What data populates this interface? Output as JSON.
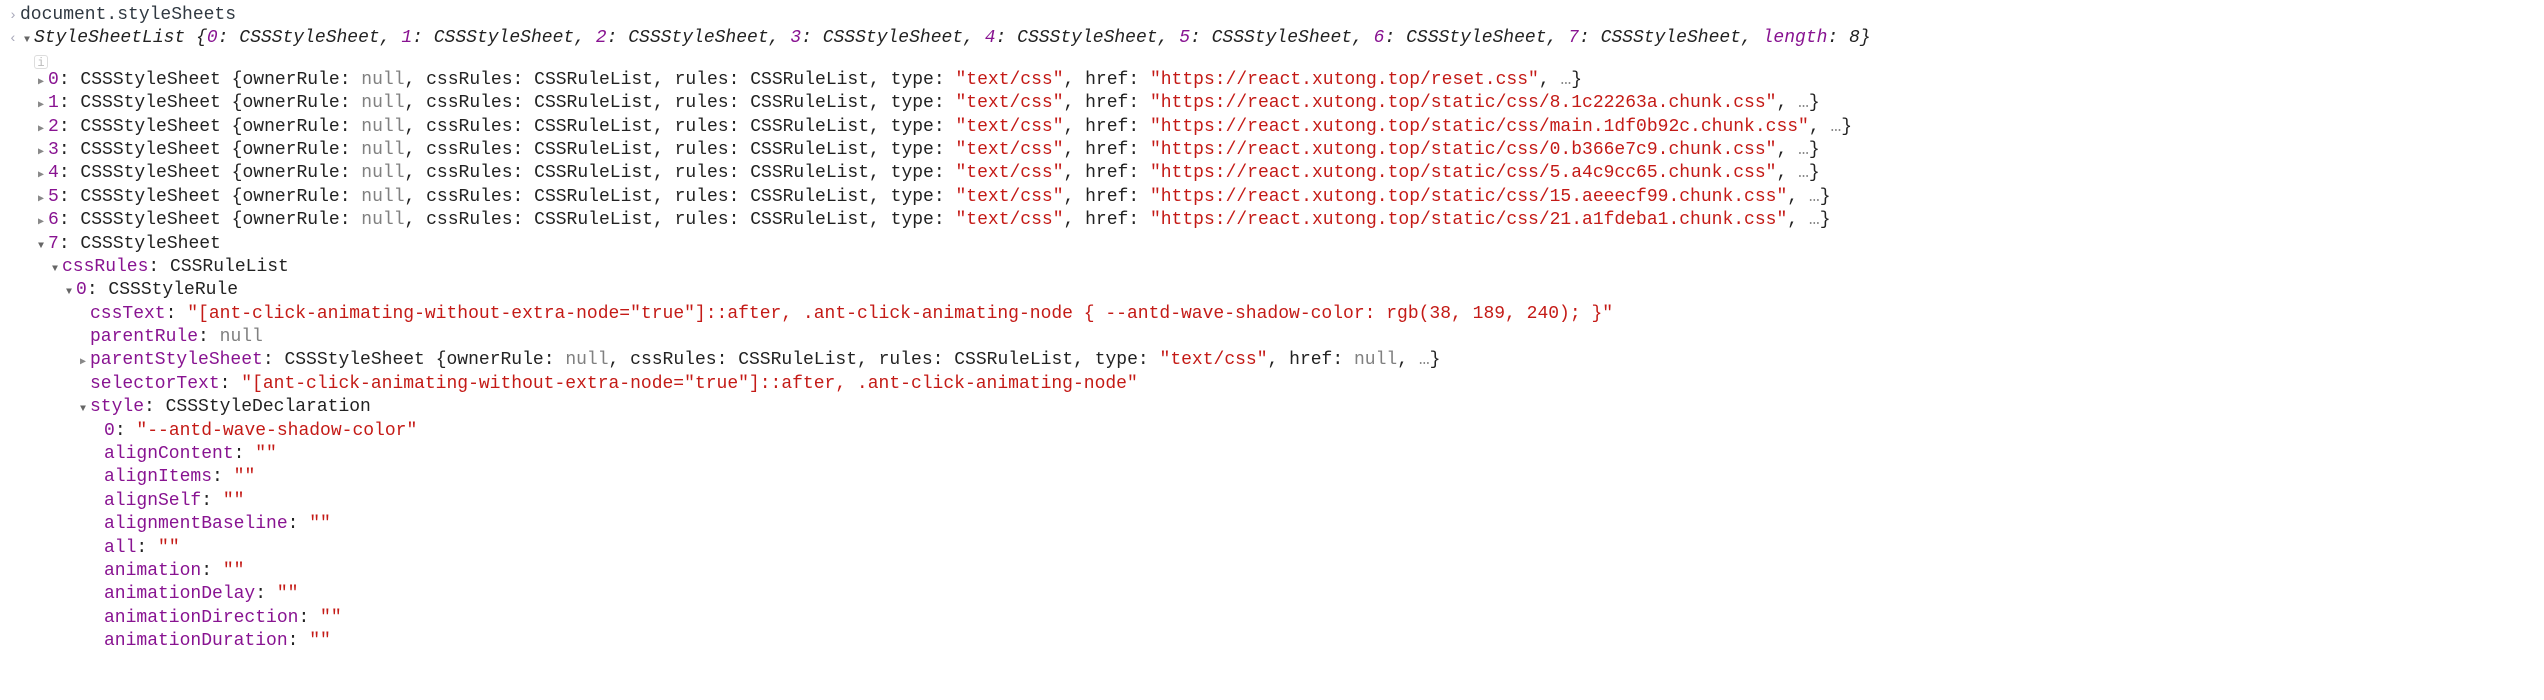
{
  "input": "document.styleSheets",
  "output_summary": {
    "type": "StyleSheetList",
    "length_label": "length",
    "length_value": "8",
    "entries": [
      {
        "k": "0",
        "v": "CSSStyleSheet"
      },
      {
        "k": "1",
        "v": "CSSStyleSheet"
      },
      {
        "k": "2",
        "v": "CSSStyleSheet"
      },
      {
        "k": "3",
        "v": "CSSStyleSheet"
      },
      {
        "k": "4",
        "v": "CSSStyleSheet"
      },
      {
        "k": "5",
        "v": "CSSStyleSheet"
      },
      {
        "k": "6",
        "v": "CSSStyleSheet"
      },
      {
        "k": "7",
        "v": "CSSStyleSheet"
      }
    ]
  },
  "sheets": [
    {
      "idx": "0",
      "href": "\"https://react.xutong.top/reset.css\""
    },
    {
      "idx": "1",
      "href": "\"https://react.xutong.top/static/css/8.1c22263a.chunk.css\""
    },
    {
      "idx": "2",
      "href": "\"https://react.xutong.top/static/css/main.1df0b92c.chunk.css\""
    },
    {
      "idx": "3",
      "href": "\"https://react.xutong.top/static/css/0.b366e7c9.chunk.css\""
    },
    {
      "idx": "4",
      "href": "\"https://react.xutong.top/static/css/5.a4c9cc65.chunk.css\""
    },
    {
      "idx": "5",
      "href": "\"https://react.xutong.top/static/css/15.aeeecf99.chunk.css\""
    },
    {
      "idx": "6",
      "href": "\"https://react.xutong.top/static/css/21.a1fdeba1.chunk.css\""
    }
  ],
  "sheet_labels": {
    "type": "CSSStyleSheet",
    "ownerRule_k": "ownerRule",
    "ownerRule_v": "null",
    "cssRules_k": "cssRules",
    "cssRules_v": "CSSRuleList",
    "rules_k": "rules",
    "rules_v": "CSSRuleList",
    "type_k": "type",
    "type_v": "\"text/css\"",
    "href_k": "href",
    "ellipsis": "…"
  },
  "sheet7": {
    "idx": "7",
    "type": "CSSStyleSheet",
    "cssRules_k": "cssRules",
    "cssRules_type": "CSSRuleList",
    "rule0_idx": "0",
    "rule0_type": "CSSStyleRule",
    "cssText_k": "cssText",
    "cssText_v": "\"[ant-click-animating-without-extra-node=\"true\"]::after, .ant-click-animating-node { --antd-wave-shadow-color: rgb(38, 189, 240); }\"",
    "parentRule_k": "parentRule",
    "parentRule_v": "null",
    "parentStyleSheet_k": "parentStyleSheet",
    "parentStyleSheet_type": "CSSStyleSheet",
    "pss_ownerRule_k": "ownerRule",
    "pss_ownerRule_v": "null",
    "pss_cssRules_k": "cssRules",
    "pss_cssRules_v": "CSSRuleList",
    "pss_rules_k": "rules",
    "pss_rules_v": "CSSRuleList",
    "pss_type_k": "type",
    "pss_type_v": "\"text/css\"",
    "pss_href_k": "href",
    "pss_href_v": "null",
    "pss_ellipsis": "…",
    "selectorText_k": "selectorText",
    "selectorText_v": "\"[ant-click-animating-without-extra-node=\"true\"]::after, .ant-click-animating-node\"",
    "style_k": "style",
    "style_type": "CSSStyleDeclaration",
    "style_entries": [
      {
        "k": "0",
        "v": "\"--antd-wave-shadow-color\"",
        "str": true
      },
      {
        "k": "alignContent",
        "v": "\"\"",
        "str": true
      },
      {
        "k": "alignItems",
        "v": "\"\"",
        "str": true
      },
      {
        "k": "alignSelf",
        "v": "\"\"",
        "str": true
      },
      {
        "k": "alignmentBaseline",
        "v": "\"\"",
        "str": true
      },
      {
        "k": "all",
        "v": "\"\"",
        "str": true
      },
      {
        "k": "animation",
        "v": "\"\"",
        "str": true
      },
      {
        "k": "animationDelay",
        "v": "\"\"",
        "str": true
      },
      {
        "k": "animationDirection",
        "v": "\"\"",
        "str": true
      },
      {
        "k": "animationDuration",
        "v": "\"\"",
        "str": true
      }
    ]
  }
}
